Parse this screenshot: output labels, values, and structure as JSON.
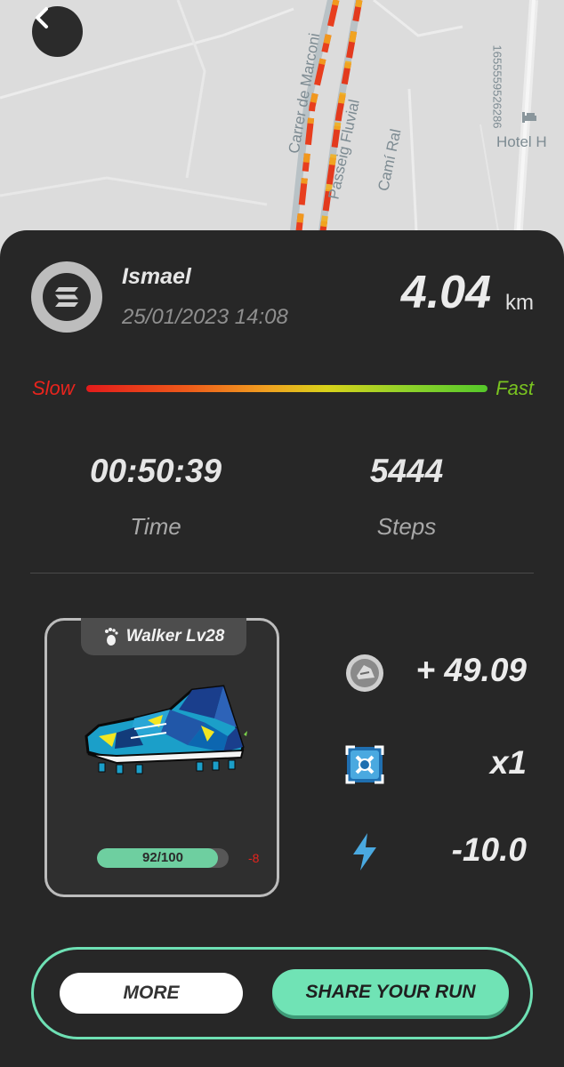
{
  "map": {
    "street_1": "Carrer de Marconi",
    "street_2": "Passeig Fluvial",
    "street_3": "Camí Ral",
    "poi": "Hotel H",
    "map_id_text": "1655559526286"
  },
  "header": {
    "back_icon": "chevron-left-icon"
  },
  "run": {
    "username": "Ismael",
    "datetime": "25/01/2023 14:08",
    "distance": "4.04",
    "distance_unit": "km",
    "speed_slow_label": "Slow",
    "speed_fast_label": "Fast",
    "time_value": "00:50:39",
    "time_label": "Time",
    "steps_value": "5444",
    "steps_label": "Steps"
  },
  "sneaker": {
    "tag": "Walker Lv28",
    "tag_icon": "footprint-icon",
    "durability_text": "92/100",
    "durability_fraction": 0.92,
    "durability_delta": "-8"
  },
  "rewards": {
    "gst": "+ 49.09",
    "gst_icon": "gst-coin-icon",
    "multiplier": "x1",
    "multiplier_icon": "shoe-boost-icon",
    "energy": "-10.0",
    "energy_icon": "lightning-icon"
  },
  "actions": {
    "more_label": "MORE",
    "share_label": "SHARE YOUR RUN"
  },
  "colors": {
    "accent": "#6ee0b4",
    "slow": "#e8241d",
    "fast": "#7ac420",
    "panel": "#272727"
  }
}
